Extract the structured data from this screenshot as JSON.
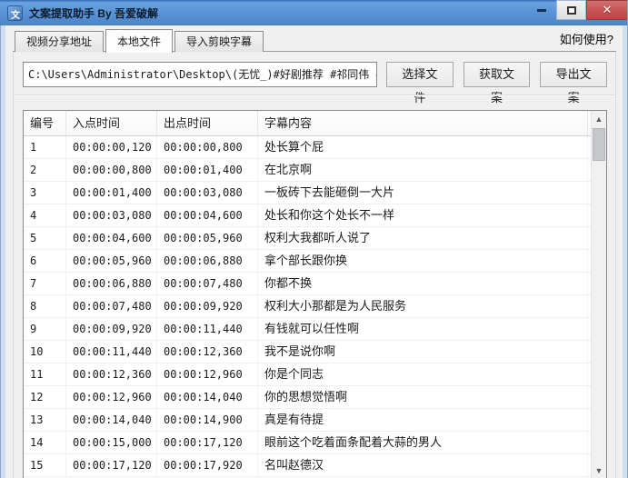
{
  "window": {
    "title": "文案提取助手 By 吾爱破解",
    "controls": {
      "minimize": "",
      "maximize": "",
      "close": "✕"
    }
  },
  "tabs": [
    {
      "label": "视频分享地址",
      "selected": false
    },
    {
      "label": "本地文件",
      "selected": true
    },
    {
      "label": "导入剪映字幕",
      "selected": false
    }
  ],
  "help_link": "如何使用?",
  "toolbar": {
    "file_path": "C:\\Users\\Administrator\\Desktop\\(无忧_)#好剧推荐 #祁同伟 #因为一个",
    "select_file_label": "选择文件",
    "get_text_label": "获取文案",
    "export_text_label": "导出文案"
  },
  "table": {
    "columns": [
      "编号",
      "入点时间",
      "出点时间",
      "字幕内容"
    ],
    "rows": [
      [
        "1",
        "00:00:00,120",
        "00:00:00,800",
        "处长算个屁"
      ],
      [
        "2",
        "00:00:00,800",
        "00:00:01,400",
        "在北京啊"
      ],
      [
        "3",
        "00:00:01,400",
        "00:00:03,080",
        "一板砖下去能砸倒一大片"
      ],
      [
        "4",
        "00:00:03,080",
        "00:00:04,600",
        "处长和你这个处长不一样"
      ],
      [
        "5",
        "00:00:04,600",
        "00:00:05,960",
        "权利大我都听人说了"
      ],
      [
        "6",
        "00:00:05,960",
        "00:00:06,880",
        "拿个部长跟你换"
      ],
      [
        "7",
        "00:00:06,880",
        "00:00:07,480",
        "你都不换"
      ],
      [
        "8",
        "00:00:07,480",
        "00:00:09,920",
        "权利大小那都是为人民服务"
      ],
      [
        "9",
        "00:00:09,920",
        "00:00:11,440",
        "有钱就可以任性啊"
      ],
      [
        "10",
        "00:00:11,440",
        "00:00:12,360",
        "我不是说你啊"
      ],
      [
        "11",
        "00:00:12,360",
        "00:00:12,960",
        "你是个同志"
      ],
      [
        "12",
        "00:00:12,960",
        "00:00:14,040",
        "你的思想觉悟啊"
      ],
      [
        "13",
        "00:00:14,040",
        "00:00:14,900",
        "真是有待提"
      ],
      [
        "14",
        "00:00:15,000",
        "00:00:17,120",
        "眼前这个吃着面条配着大蒜的男人"
      ],
      [
        "15",
        "00:00:17,120",
        "00:00:17,920",
        "名叫赵德汉"
      ]
    ]
  },
  "scrollbar": {
    "up_glyph": "▲",
    "down_glyph": "▼"
  },
  "colors": {
    "titlebar_blue": "#5891d4",
    "window_border": "#cfdff2",
    "close_red": "#c75050",
    "content_bg": "#f0f0f0"
  }
}
